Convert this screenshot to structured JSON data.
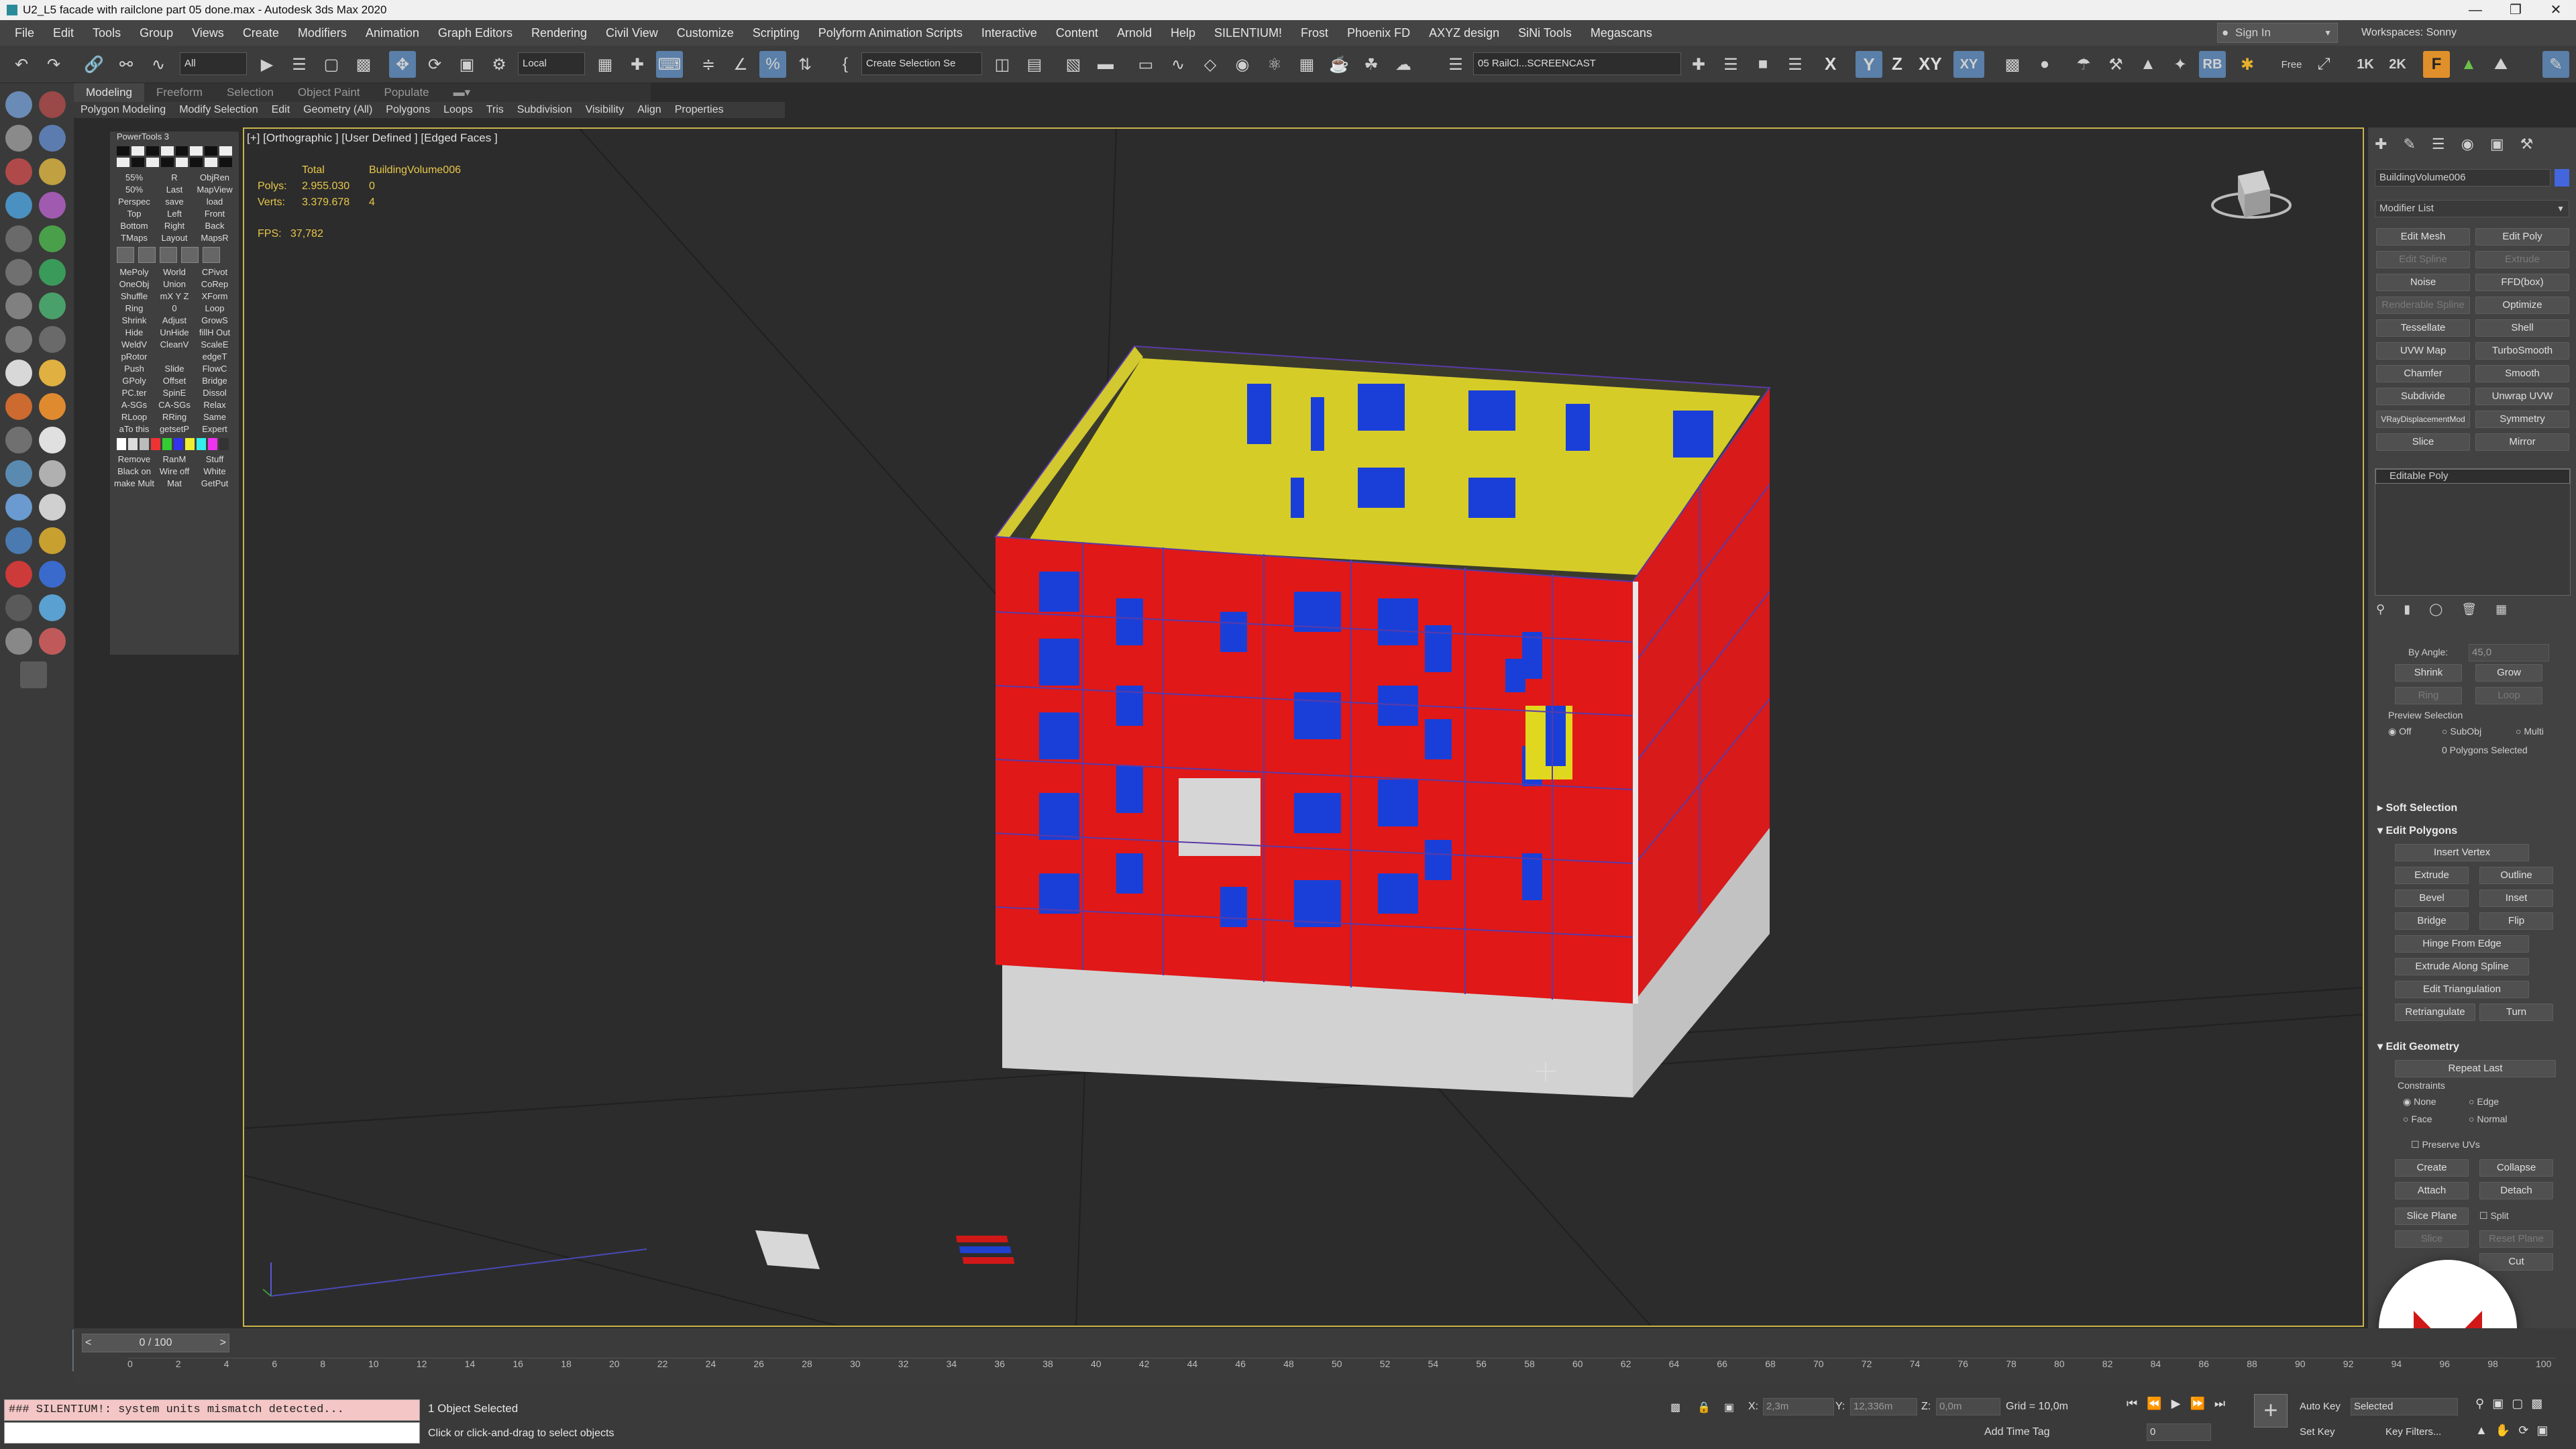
{
  "window": {
    "title": "U2_L5 facade with railclone part 05 done.max - Autodesk 3ds Max 2020",
    "controls": [
      "—",
      "❐",
      "✕"
    ]
  },
  "menu": [
    "File",
    "Edit",
    "Tools",
    "Group",
    "Views",
    "Create",
    "Modifiers",
    "Animation",
    "Graph Editors",
    "Rendering",
    "Civil View",
    "Customize",
    "Scripting",
    "Polyform Animation Scripts",
    "Interactive",
    "Content",
    "Arnold",
    "Help",
    "SILENTIUM!",
    "Frost",
    "Phoenix FD",
    "AXYZ design",
    "SiNi Tools",
    "Megascans"
  ],
  "account": {
    "sign_in": "Sign In",
    "workspaces_label": "Workspaces:",
    "workspace": "Sonny"
  },
  "toolbar": {
    "filter": "All",
    "coord_system": "Local",
    "selection_set": "Create Selection Se",
    "layer_dropdown": "05 RailCl...SCREENCAST",
    "axis_x": "X",
    "axis_y": "Y",
    "axis_z": "Z",
    "axis_xy": "XY",
    "axis_xy2": "XY",
    "res_1k": "1K",
    "res_2k": "2K",
    "rb": "RB",
    "free": "Free"
  },
  "ribbon": {
    "tabs": [
      "Modeling",
      "Freeform",
      "Selection",
      "Object Paint",
      "Populate"
    ],
    "active": "Modeling",
    "sub": [
      "Polygon Modeling",
      "Modify Selection",
      "Edit",
      "Geometry (All)",
      "Polygons",
      "Loops",
      "Tris",
      "Subdivision",
      "Visibility",
      "Align",
      "Properties"
    ]
  },
  "polytools": {
    "title": "PowerTools 3",
    "rows": [
      [
        "55%",
        "R",
        "ObjRen"
      ],
      [
        "50%",
        "Last",
        "MapView"
      ],
      [
        "Perspec",
        "save",
        "load"
      ],
      [
        "Top",
        "Left",
        "Front"
      ],
      [
        "Bottom",
        "Right",
        "Back"
      ],
      [
        "TMaps",
        "Layout",
        "MapsR"
      ],
      [
        "MePoly",
        "World",
        "CPivot"
      ],
      [
        "OneObj",
        "Union",
        "CoRep"
      ],
      [
        "Shuffle",
        "mX Y Z",
        "XForm"
      ],
      [
        "Ring",
        "0",
        "Loop"
      ],
      [
        "Shrink",
        "Adjust",
        "GrowS"
      ],
      [
        "Hide",
        "UnHide",
        "fillH Out"
      ],
      [
        "WeldV",
        "CleanV",
        "ScaleE"
      ],
      [
        "pRotor",
        "",
        "edgeT"
      ],
      [
        "Push",
        "Slide",
        "FlowC"
      ],
      [
        "GPoly",
        "Offset",
        "Bridge"
      ],
      [
        "PC.ter",
        "SpinE",
        "Dissol"
      ],
      [
        "A-SGs",
        "CA-SGs",
        "Relax"
      ],
      [
        "RLoop",
        "RRing",
        "Same"
      ],
      [
        "aTo this",
        "getsetP",
        "Expert"
      ],
      [
        "Remove",
        "RanM",
        "Stuff"
      ],
      [
        "Black on",
        "Wire off",
        "White"
      ],
      [
        "make Multi",
        "Mat",
        "GetPut"
      ]
    ]
  },
  "viewport": {
    "label": "[+] [Orthographic ] [User Defined ] [Edged Faces ]",
    "stats": {
      "header_total": "Total",
      "header_obj": "BuildingVolume006",
      "polys_label": "Polys:",
      "polys_total": "2.955.030",
      "polys_obj": "0",
      "verts_label": "Verts:",
      "verts_total": "3.379.678",
      "verts_obj": "4"
    },
    "fps_label": "FPS:",
    "fps": "37,782"
  },
  "command_panel": {
    "object_name": "BuildingVolume006",
    "object_color": "#4466dd",
    "modifier_list": "Modifier List",
    "mod_buttons": [
      [
        "Edit Mesh",
        "Edit Poly"
      ],
      [
        "Edit Spline",
        "Extrude"
      ],
      [
        "Noise",
        "FFD(box)"
      ],
      [
        "Renderable Spline",
        "Optimize"
      ],
      [
        "Tessellate",
        "Shell"
      ],
      [
        "UVW Map",
        "TurboSmooth"
      ],
      [
        "Chamfer",
        "Smooth"
      ],
      [
        "Subdivide",
        "Unwrap UVW"
      ],
      [
        "VRayDisplacementMod",
        "Symmetry"
      ],
      [
        "Slice",
        "Mirror"
      ]
    ],
    "stack_item": "Editable Poly",
    "by_angle": "By Angle:",
    "angle_val": "45,0",
    "shrink": "Shrink",
    "grow": "Grow",
    "ring": "Ring",
    "loop": "Loop",
    "preview_selection": "Preview Selection",
    "preview_opts": [
      "Off",
      "SubObj",
      "Multi"
    ],
    "polys_selected": "0 Polygons Selected",
    "soft_selection": "Soft Selection",
    "edit_polygons": "Edit Polygons",
    "insert_vertex": "Insert Vertex",
    "ep_buttons": [
      [
        "Extrude",
        "Outline"
      ],
      [
        "Bevel",
        "Inset"
      ],
      [
        "Bridge",
        "Flip"
      ]
    ],
    "hinge": "Hinge From Edge",
    "extrude_spline": "Extrude Along Spline",
    "edit_tri": "Edit Triangulation",
    "retriangulate": "Retriangulate",
    "turn": "Turn",
    "edit_geometry": "Edit Geometry",
    "repeat_last": "Repeat Last",
    "constraints": "Constraints",
    "constraint_opts": [
      "None",
      "Edge",
      "Face",
      "Normal"
    ],
    "preserve_uvs": "Preserve UVs",
    "create": "Create",
    "collapse": "Collapse",
    "attach": "Attach",
    "detach": "Detach",
    "slice_plane": "Slice Plane",
    "split": "Split",
    "slice": "Slice",
    "reset_plane": "Reset Plane",
    "cut": "Cut"
  },
  "timeline": {
    "frame": "0 / 100",
    "ticks": [
      "0",
      "2",
      "4",
      "6",
      "8",
      "10",
      "12",
      "14",
      "16",
      "18",
      "20",
      "22",
      "24",
      "26",
      "28",
      "30",
      "32",
      "34",
      "36",
      "38",
      "40",
      "42",
      "44",
      "46",
      "48",
      "50",
      "52",
      "54",
      "56",
      "58",
      "60",
      "62",
      "64",
      "66",
      "68",
      "70",
      "72",
      "74",
      "76",
      "78",
      "80",
      "82",
      "84",
      "86",
      "88",
      "90",
      "92",
      "94",
      "96",
      "98",
      "100"
    ]
  },
  "status": {
    "maxscript": "### SILENTIUM!: system units mismatch detected...",
    "selected": "1 Object Selected",
    "prompt": "Click or click-and-drag to select objects",
    "x_label": "X:",
    "x_val": "2,3m",
    "y_label": "Y:",
    "y_val": "12,336m",
    "z_label": "Z:",
    "z_val": "0,0m",
    "grid": "Grid = 10,0m",
    "add_time_tag": "Add Time Tag",
    "auto_key": "Auto Key",
    "selected_dd": "Selected",
    "set_key": "Set Key",
    "key_filters": "Key Filters...",
    "frame_input": "0"
  }
}
